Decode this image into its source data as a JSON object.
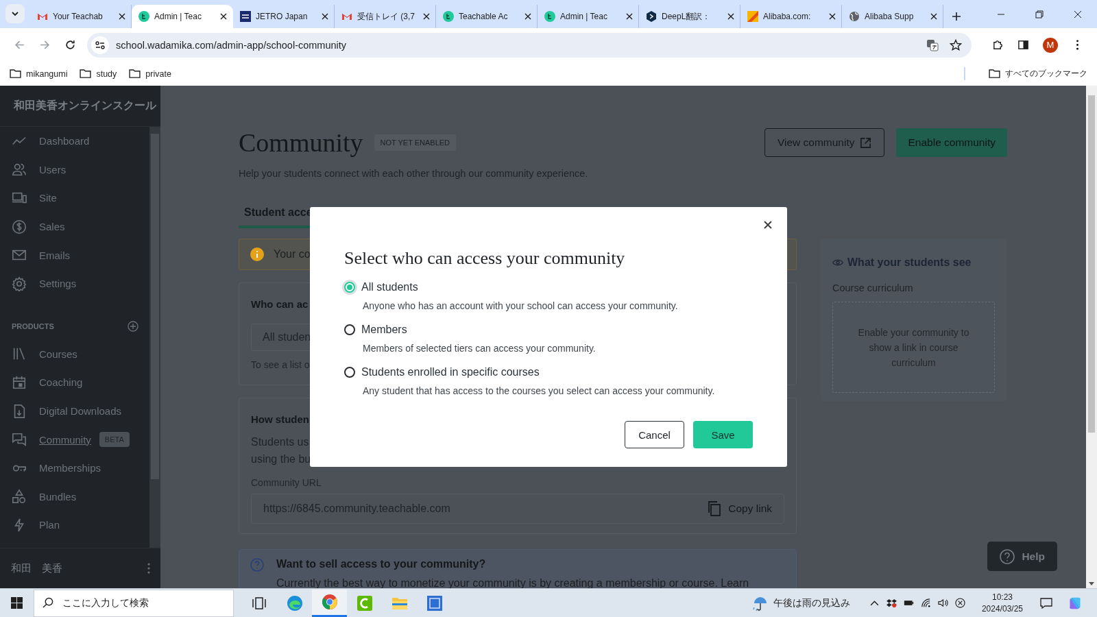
{
  "browser": {
    "tabs": [
      {
        "title": "Your Teachab",
        "selected": false
      },
      {
        "title": "Admin | Teac",
        "selected": true
      },
      {
        "title": "JETRO Japan",
        "selected": false
      },
      {
        "title": "受信トレイ (3,7",
        "selected": false
      },
      {
        "title": "Teachable Ac",
        "selected": false
      },
      {
        "title": "Admin | Teac",
        "selected": false
      },
      {
        "title": "DeepL翻訳：",
        "selected": false
      },
      {
        "title": "Alibaba.com:",
        "selected": false
      },
      {
        "title": "Alibaba Supp",
        "selected": false
      }
    ],
    "url": "school.wadamika.com/admin-app/school-community",
    "profile_initial": "M",
    "bookmarks": [
      "mikangumi",
      "study",
      "private"
    ],
    "all_bookmarks": "すべてのブックマーク"
  },
  "sidebar": {
    "school_name": "和田美香オンラインスクール",
    "items": [
      {
        "label": "Dashboard",
        "selected": false
      },
      {
        "label": "Users",
        "selected": false
      },
      {
        "label": "Site",
        "selected": false
      },
      {
        "label": "Sales",
        "selected": false
      },
      {
        "label": "Emails",
        "selected": false
      },
      {
        "label": "Settings",
        "selected": false
      }
    ],
    "section_label": "PRODUCTS",
    "products": [
      {
        "label": "Courses",
        "selected": false
      },
      {
        "label": "Coaching",
        "selected": false
      },
      {
        "label": "Digital Downloads",
        "selected": false
      },
      {
        "label": "Community",
        "selected": true,
        "badge": "BETA"
      },
      {
        "label": "Memberships",
        "selected": false
      },
      {
        "label": "Bundles",
        "selected": false
      },
      {
        "label": "Plan",
        "selected": false
      }
    ],
    "user_name": "和田　美香"
  },
  "page": {
    "title": "Community",
    "status_badge": "NOT YET ENABLED",
    "subtitle": "Help your students connect with each other through our community experience.",
    "view_button": "View community",
    "enable_button": "Enable community",
    "tabs": [
      {
        "label": "Student acce",
        "selected": true
      }
    ],
    "alert": "Your co",
    "access_card": {
      "heading": "Who can ac",
      "field_value": "All studen",
      "note": "To see a list o"
    },
    "url_card": {
      "heading": "How studen",
      "text_lines": [
        "Students us",
        "using the bu"
      ],
      "url_label": "Community URL",
      "url": "https://6845.community.teachable.com",
      "copy_button": "Copy link"
    },
    "promo": {
      "heading": "Want to sell access to your community?",
      "text": "Currently the best way to monetize your community is by creating a membership or course. Learn"
    },
    "preview": {
      "heading": "What your students see",
      "label": "Course curriculum",
      "placeholder": "Enable your community to show a link in course curriculum"
    },
    "help_button": "Help"
  },
  "modal": {
    "title": "Select who can access your community",
    "options": [
      {
        "label": "All students",
        "description": "Anyone who has an account with your school can access your community.",
        "selected": true
      },
      {
        "label": "Members",
        "description": "Members of selected tiers can access your community.",
        "selected": false
      },
      {
        "label": "Students enrolled in specific courses",
        "description": "Any student that has access to the courses you select can access your community.",
        "selected": false
      }
    ],
    "cancel_button": "Cancel",
    "save_button": "Save"
  },
  "taskbar": {
    "search_placeholder": "ここに入力して検索",
    "apps": [
      {
        "selected": false
      },
      {
        "selected": false
      },
      {
        "selected": true
      },
      {
        "selected": false
      },
      {
        "selected": false
      },
      {
        "selected": false
      }
    ],
    "weather": "午後は雨の見込み",
    "time": "10:23",
    "date": "2024/03/25"
  }
}
